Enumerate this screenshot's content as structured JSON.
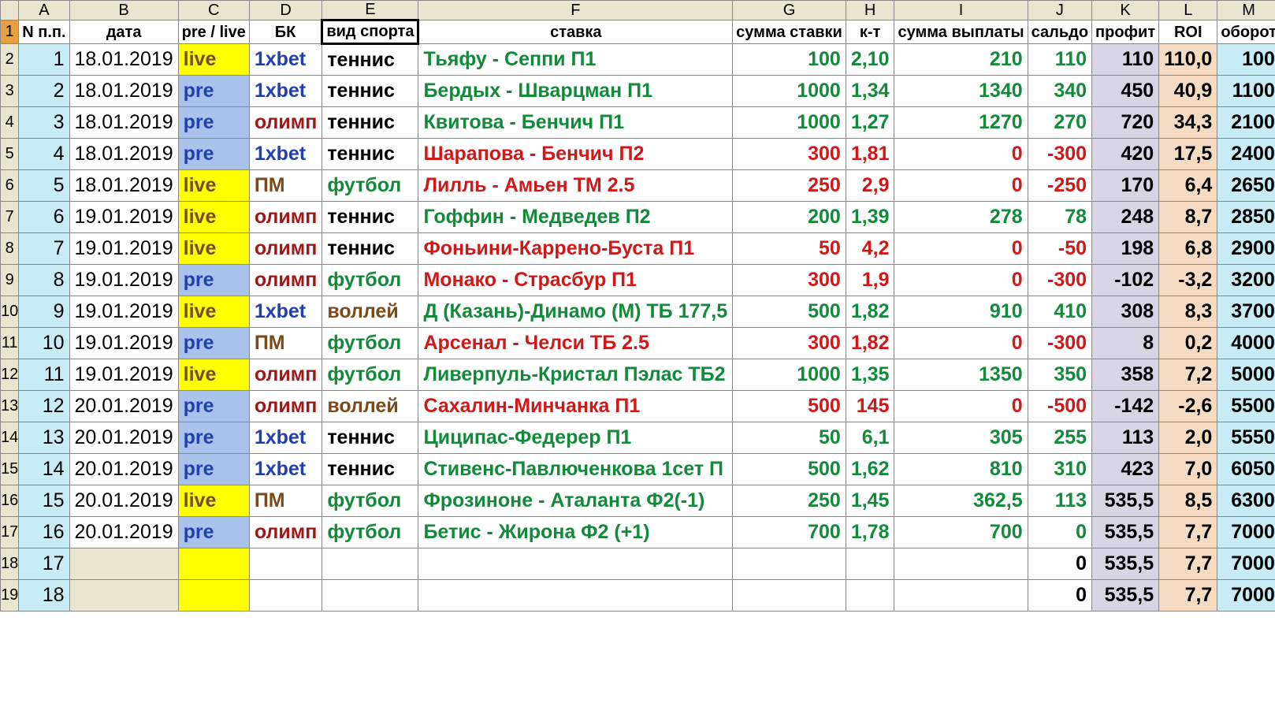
{
  "columns": [
    "A",
    "B",
    "C",
    "D",
    "E",
    "F",
    "G",
    "H",
    "I",
    "J",
    "K",
    "L",
    "M"
  ],
  "headers": {
    "A": "N п.п.",
    "B": "дата",
    "C": "pre / live",
    "D": "БК",
    "E": "вид спорта",
    "F": "ставка",
    "G": "сумма ставки",
    "H": "к-т",
    "I": "сумма выплаты",
    "J": "сальдо",
    "K": "профит",
    "L": "ROI",
    "M": "оборот"
  },
  "selected_column": "E",
  "rows": [
    {
      "n": "1",
      "date": "18.01.2019",
      "pl": "live",
      "bk": "1xbet",
      "sport": "теннис",
      "bet": "Тьяфу - Сеппи П1",
      "sum": "100",
      "kt": "2,10",
      "pay": "210",
      "saldo": "110",
      "profit": "110",
      "roi": "110,0",
      "turn": "100",
      "outcome": "win",
      "bk_color": "blue",
      "sport_color": "black"
    },
    {
      "n": "2",
      "date": "18.01.2019",
      "pl": "pre",
      "bk": "1xbet",
      "sport": "теннис",
      "bet": "Бердых - Шварцман П1",
      "sum": "1000",
      "kt": "1,34",
      "pay": "1340",
      "saldo": "340",
      "profit": "450",
      "roi": "40,9",
      "turn": "1100",
      "outcome": "win",
      "bk_color": "blue",
      "sport_color": "black"
    },
    {
      "n": "3",
      "date": "18.01.2019",
      "pl": "pre",
      "bk": "олимп",
      "sport": "теннис",
      "bet": "Квитова - Бенчич П1",
      "sum": "1000",
      "kt": "1,27",
      "pay": "1270",
      "saldo": "270",
      "profit": "720",
      "roi": "34,3",
      "turn": "2100",
      "outcome": "win",
      "bk_color": "darkred",
      "sport_color": "black"
    },
    {
      "n": "4",
      "date": "18.01.2019",
      "pl": "pre",
      "bk": "1xbet",
      "sport": "теннис",
      "bet": "Шарапова - Бенчич П2",
      "sum": "300",
      "kt": "1,81",
      "pay": "0",
      "saldo": "-300",
      "profit": "420",
      "roi": "17,5",
      "turn": "2400",
      "outcome": "loss",
      "bk_color": "blue",
      "sport_color": "black"
    },
    {
      "n": "5",
      "date": "18.01.2019",
      "pl": "live",
      "bk": "ПМ",
      "sport": "футбол",
      "bet": "Лилль - Амьен ТМ 2.5",
      "sum": "250",
      "kt": "2,9",
      "pay": "0",
      "saldo": "-250",
      "profit": "170",
      "roi": "6,4",
      "turn": "2650",
      "outcome": "loss",
      "bk_color": "brown",
      "sport_color": "green"
    },
    {
      "n": "6",
      "date": "19.01.2019",
      "pl": "live",
      "bk": "олимп",
      "sport": "теннис",
      "bet": "Гоффин - Медведев П2",
      "sum": "200",
      "kt": "1,39",
      "pay": "278",
      "saldo": "78",
      "profit": "248",
      "roi": "8,7",
      "turn": "2850",
      "outcome": "win",
      "bk_color": "darkred",
      "sport_color": "black"
    },
    {
      "n": "7",
      "date": "19.01.2019",
      "pl": "live",
      "bk": "олимп",
      "sport": "теннис",
      "bet": "Фоньини-Каррено-Буста П1",
      "sum": "50",
      "kt": "4,2",
      "pay": "0",
      "saldo": "-50",
      "profit": "198",
      "roi": "6,8",
      "turn": "2900",
      "outcome": "loss",
      "bk_color": "darkred",
      "sport_color": "black"
    },
    {
      "n": "8",
      "date": "19.01.2019",
      "pl": "pre",
      "bk": "олимп",
      "sport": "футбол",
      "bet": "Монако - Страсбур П1",
      "sum": "300",
      "kt": "1,9",
      "pay": "0",
      "saldo": "-300",
      "profit": "-102",
      "roi": "-3,2",
      "turn": "3200",
      "outcome": "loss",
      "bk_color": "darkred",
      "sport_color": "green"
    },
    {
      "n": "9",
      "date": "19.01.2019",
      "pl": "live",
      "bk": "1xbet",
      "sport": "воллей",
      "bet": "Д (Казань)-Динамо (М) ТБ 177,5",
      "sum": "500",
      "kt": "1,82",
      "pay": "910",
      "saldo": "410",
      "profit": "308",
      "roi": "8,3",
      "turn": "3700",
      "outcome": "win",
      "bk_color": "blue",
      "sport_color": "brown"
    },
    {
      "n": "10",
      "date": "19.01.2019",
      "pl": "pre",
      "bk": "ПМ",
      "sport": "футбол",
      "bet": "Арсенал - Челси ТБ 2.5",
      "sum": "300",
      "kt": "1,82",
      "pay": "0",
      "saldo": "-300",
      "profit": "8",
      "roi": "0,2",
      "turn": "4000",
      "outcome": "loss",
      "bk_color": "brown",
      "sport_color": "green"
    },
    {
      "n": "11",
      "date": "19.01.2019",
      "pl": "live",
      "bk": "олимп",
      "sport": "футбол",
      "bet": "Ливерпуль-Кристал Пэлас ТБ2",
      "sum": "1000",
      "kt": "1,35",
      "pay": "1350",
      "saldo": "350",
      "profit": "358",
      "roi": "7,2",
      "turn": "5000",
      "outcome": "win",
      "bk_color": "darkred",
      "sport_color": "green"
    },
    {
      "n": "12",
      "date": "20.01.2019",
      "pl": "pre",
      "bk": "олимп",
      "sport": "воллей",
      "bet": "Сахалин-Минчанка П1",
      "sum": "500",
      "kt": "145",
      "pay": "0",
      "saldo": "-500",
      "profit": "-142",
      "roi": "-2,6",
      "turn": "5500",
      "outcome": "loss",
      "bk_color": "darkred",
      "sport_color": "brown"
    },
    {
      "n": "13",
      "date": "20.01.2019",
      "pl": "pre",
      "bk": "1xbet",
      "sport": "теннис",
      "bet": "Циципас-Федерер П1",
      "sum": "50",
      "kt": "6,1",
      "pay": "305",
      "saldo": "255",
      "profit": "113",
      "roi": "2,0",
      "turn": "5550",
      "outcome": "win",
      "bk_color": "blue",
      "sport_color": "black"
    },
    {
      "n": "14",
      "date": "20.01.2019",
      "pl": "pre",
      "bk": "1xbet",
      "sport": "теннис",
      "bet": "Стивенс-Павлюченкова 1сет П",
      "sum": "500",
      "kt": "1,62",
      "pay": "810",
      "saldo": "310",
      "profit": "423",
      "roi": "7,0",
      "turn": "6050",
      "outcome": "win",
      "bk_color": "blue",
      "sport_color": "black"
    },
    {
      "n": "15",
      "date": "20.01.2019",
      "pl": "live",
      "bk": "ПМ",
      "sport": "футбол",
      "bet": "Фрозиноне - Аталанта Ф2(-1)",
      "sum": "250",
      "kt": "1,45",
      "pay": "362,5",
      "saldo": "113",
      "profit": "535,5",
      "roi": "8,5",
      "turn": "6300",
      "outcome": "win",
      "bk_color": "brown",
      "sport_color": "green"
    },
    {
      "n": "16",
      "date": "20.01.2019",
      "pl": "pre",
      "bk": "олимп",
      "sport": "футбол",
      "bet": "Бетис - Жирона Ф2 (+1)",
      "sum": "700",
      "kt": "1,78",
      "pay": "700",
      "saldo": "0",
      "profit": "535,5",
      "roi": "7,7",
      "turn": "7000",
      "outcome": "win",
      "bk_color": "darkred",
      "sport_color": "green"
    },
    {
      "n": "17",
      "date": "",
      "pl": "",
      "bk": "",
      "sport": "",
      "bet": "",
      "sum": "",
      "kt": "",
      "pay": "",
      "saldo": "0",
      "profit": "535,5",
      "roi": "7,7",
      "turn": "7000",
      "outcome": "empty",
      "bk_color": "",
      "sport_color": ""
    },
    {
      "n": "18",
      "date": "",
      "pl": "",
      "bk": "",
      "sport": "",
      "bet": "",
      "sum": "",
      "kt": "",
      "pay": "",
      "saldo": "0",
      "profit": "535,5",
      "roi": "7,7",
      "turn": "7000",
      "outcome": "empty",
      "bk_color": "",
      "sport_color": ""
    }
  ]
}
